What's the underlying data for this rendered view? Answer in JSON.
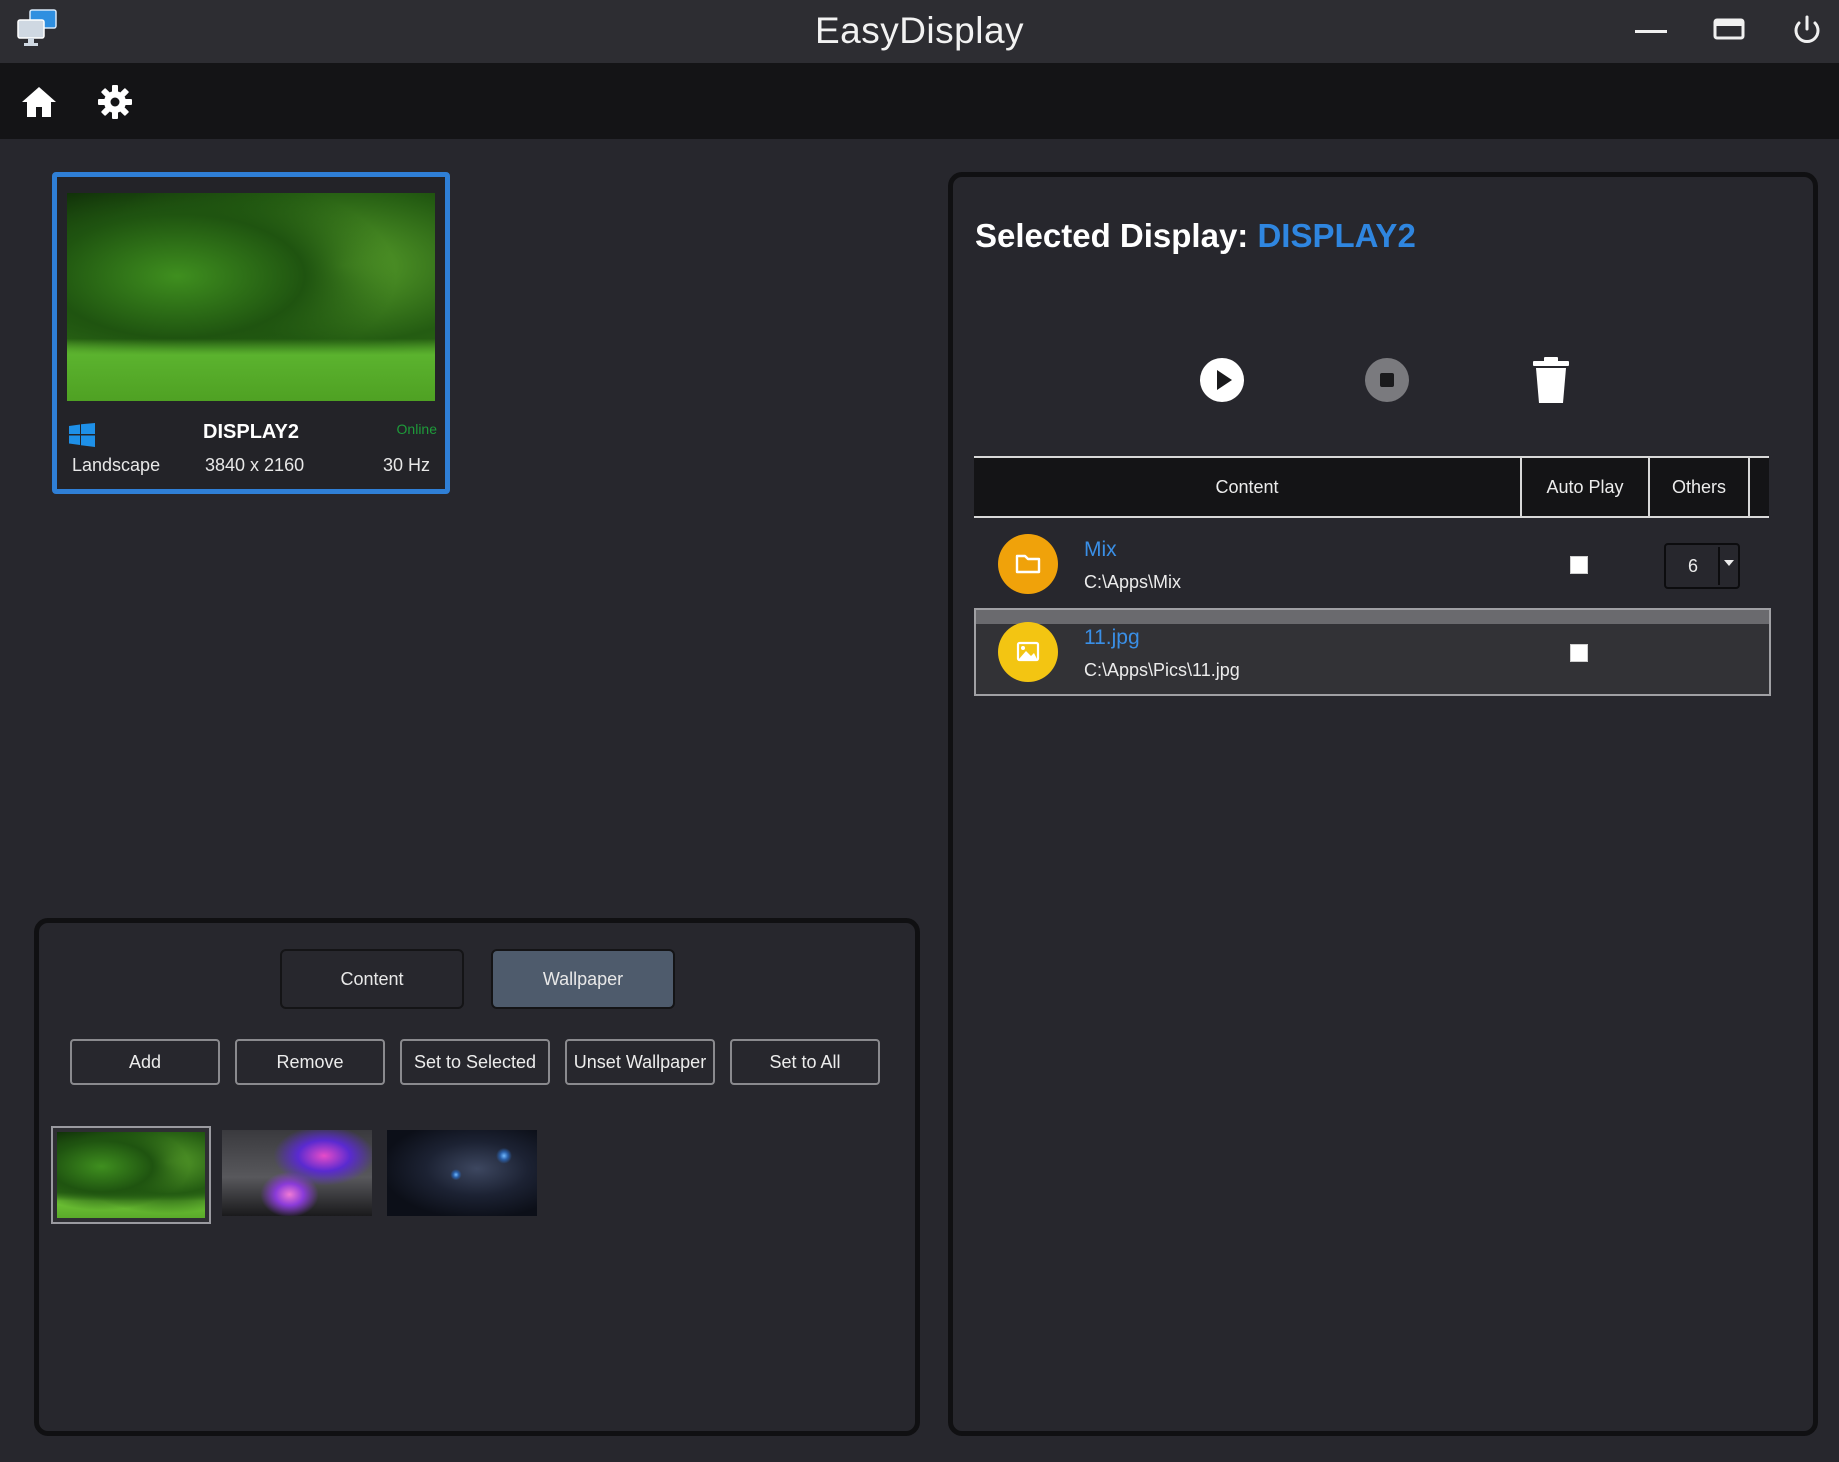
{
  "app": {
    "title": "EasyDisplay"
  },
  "display_card": {
    "name": "DISPLAY2",
    "status": "Online",
    "orientation": "Landscape",
    "resolution": "3840 x 2160",
    "refresh": "30 Hz",
    "selected": true
  },
  "tabs": {
    "content": "Content",
    "wallpaper": "Wallpaper",
    "active": "Wallpaper"
  },
  "actions": {
    "add": "Add",
    "remove": "Remove",
    "set_selected": "Set to Selected",
    "unset": "Unset Wallpaper",
    "set_all": "Set to All"
  },
  "wallpapers": [
    "forest",
    "galaxy-bottle",
    "black-cat"
  ],
  "right_panel": {
    "title_prefix": "Selected Display:",
    "title_name": "DISPLAY2",
    "columns": {
      "content": "Content",
      "autoplay": "Auto Play",
      "others": "Others"
    },
    "rows": [
      {
        "name": "Mix",
        "path": "C:\\Apps\\Mix",
        "icon": "folder-icon",
        "autoplay": false,
        "others": "6"
      },
      {
        "name": "11.jpg",
        "path": "C:\\Apps\\Pics\\11.jpg",
        "icon": "image-icon",
        "autoplay": false
      }
    ]
  },
  "colors": {
    "accent": "#2f86e0",
    "online": "#1e9a3a",
    "folder": "#f0a20a",
    "image": "#f3c512"
  }
}
